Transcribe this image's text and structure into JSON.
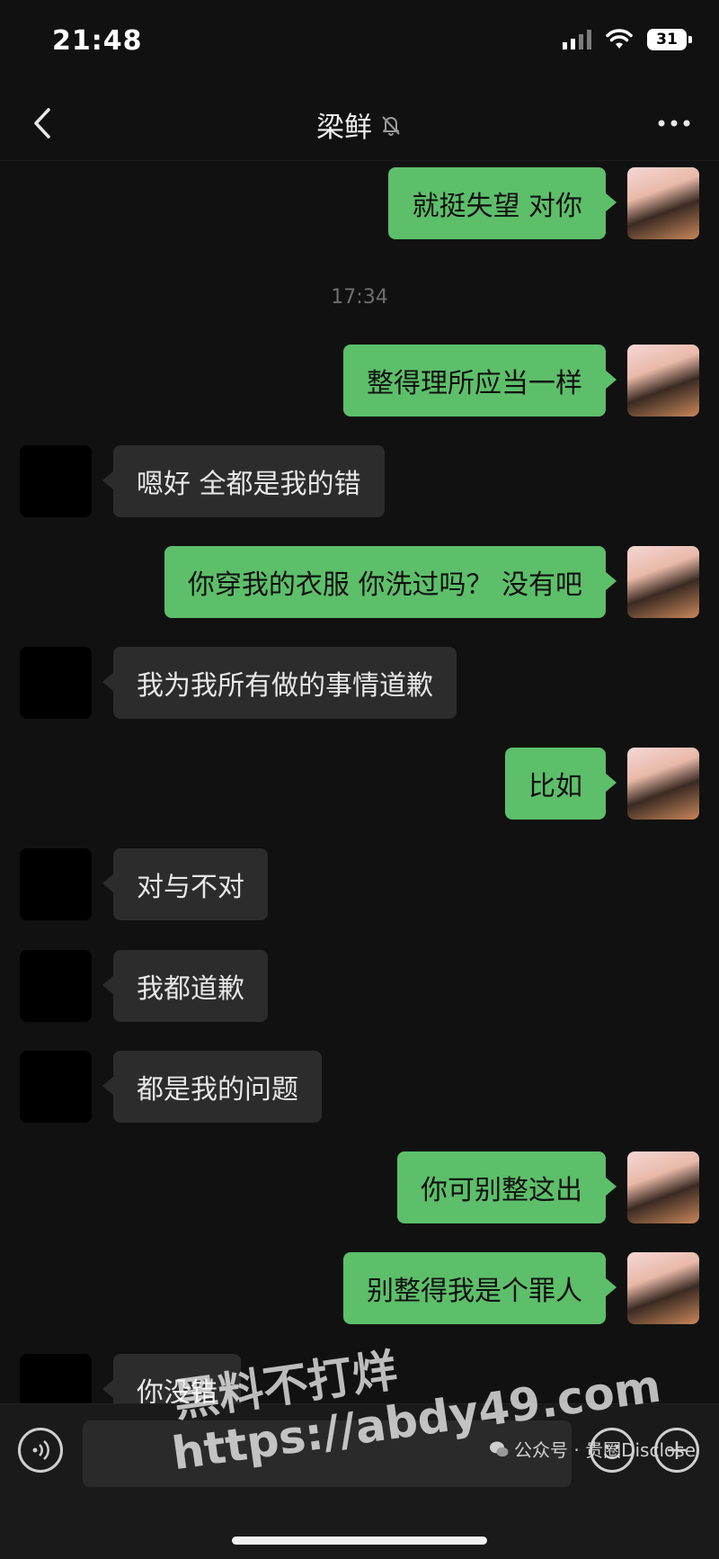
{
  "status_bar": {
    "time": "21:48",
    "battery": "31"
  },
  "header": {
    "title": "梁鲜"
  },
  "timestamp": "17:34",
  "messages": [
    {
      "from": "me",
      "text": "就挺失望 对你"
    },
    {
      "from": "me",
      "text": "整得理所应当一样"
    },
    {
      "from": "other",
      "text": "嗯好 全都是我的错"
    },
    {
      "from": "me",
      "text": "你穿我的衣服 你洗过吗？ 没有吧"
    },
    {
      "from": "other",
      "text": "我为我所有做的事情道歉"
    },
    {
      "from": "me",
      "text": "比如"
    },
    {
      "from": "other",
      "text": "对与不对"
    },
    {
      "from": "other",
      "text": "我都道歉"
    },
    {
      "from": "other",
      "text": "都是我的问题"
    },
    {
      "from": "me",
      "text": "你可别整这出"
    },
    {
      "from": "me",
      "text": "别整得我是个罪人"
    },
    {
      "from": "other",
      "text": "你没错"
    }
  ],
  "input_bar": {
    "placeholder": ""
  },
  "watermark": {
    "line1": "黑料不打烊",
    "line2": "https://abdy49.com",
    "source": "公众号 · 贵圈Disclose"
  },
  "colors": {
    "outgoing_bubble": "#5dbf6a",
    "incoming_bubble": "#2c2c2c",
    "background": "#111111"
  }
}
